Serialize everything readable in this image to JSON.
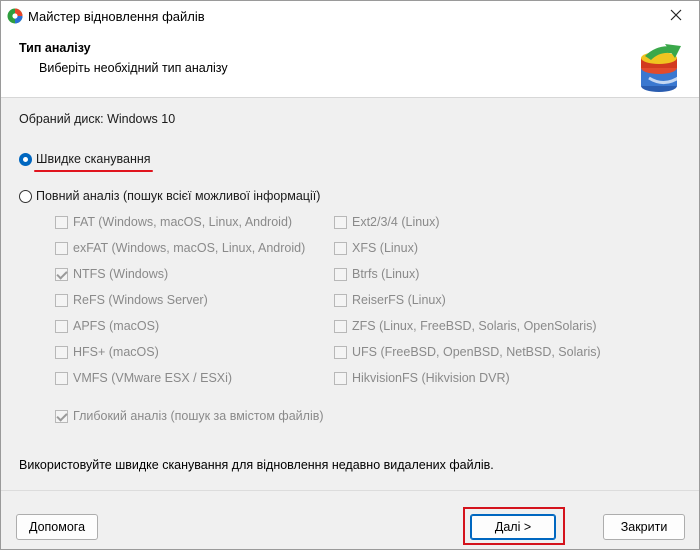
{
  "window": {
    "title": "Майстер відновлення файлів",
    "icons": {
      "app": "app-logo-icon",
      "close": "close-icon",
      "header_logo": "recovery-logo-icon"
    }
  },
  "header": {
    "title": "Тип аналізу",
    "subtitle": "Виберіть необхідний тип аналізу"
  },
  "selected_disk": "Обраний диск: Windows 10",
  "scan_options": {
    "quick": {
      "label": "Швидке сканування",
      "checked": true
    },
    "full": {
      "label": "Повний аналіз (пошук всієї можливої інформації)",
      "checked": false
    }
  },
  "filesystems_left": [
    {
      "label": "FAT (Windows, macOS, Linux, Android)",
      "checked": false
    },
    {
      "label": "exFAT (Windows, macOS, Linux, Android)",
      "checked": false
    },
    {
      "label": "NTFS (Windows)",
      "checked": true
    },
    {
      "label": "ReFS (Windows Server)",
      "checked": false
    },
    {
      "label": "APFS (macOS)",
      "checked": false
    },
    {
      "label": "HFS+ (macOS)",
      "checked": false
    },
    {
      "label": "VMFS (VMware ESX / ESXi)",
      "checked": false
    }
  ],
  "filesystems_right": [
    {
      "label": "Ext2/3/4 (Linux)",
      "checked": false
    },
    {
      "label": "XFS (Linux)",
      "checked": false
    },
    {
      "label": "Btrfs (Linux)",
      "checked": false
    },
    {
      "label": "ReiserFS (Linux)",
      "checked": false
    },
    {
      "label": "ZFS (Linux, FreeBSD, Solaris, OpenSolaris)",
      "checked": false
    },
    {
      "label": "UFS (FreeBSD, OpenBSD, NetBSD, Solaris)",
      "checked": false
    },
    {
      "label": "HikvisionFS (Hikvision DVR)",
      "checked": false
    }
  ],
  "deep_analysis": {
    "label": "Глибокий аналіз (пошук за вмістом файлів)",
    "checked": true
  },
  "hint": "Використовуйте швидке сканування для відновлення недавно видалених файлів.",
  "buttons": {
    "help": "Допомога",
    "next": "Далі >",
    "cancel": "Закрити"
  },
  "colors": {
    "accent": "#0067c0",
    "highlight": "#d4131c",
    "disabled_text": "#8a8a8a"
  }
}
